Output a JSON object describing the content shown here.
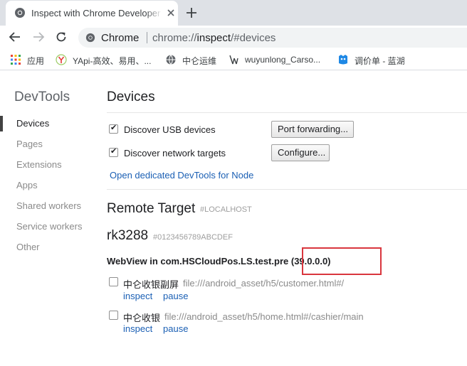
{
  "tab": {
    "title": "Inspect with Chrome Developer Tools"
  },
  "omnibox": {
    "scheme_label": "Chrome",
    "url_prefix": "chrome://",
    "url_host": "inspect",
    "url_path": "/#devices"
  },
  "bookmarks": [
    {
      "label": "应用",
      "icon": "apps-grid-icon"
    },
    {
      "label": "YApi-高效、易用、...",
      "icon": "yapi-icon"
    },
    {
      "label": "中仑运维",
      "icon": "globe-icon"
    },
    {
      "label": "wuyunlong_Carso...",
      "icon": "page-icon"
    },
    {
      "label": "调价单 - 蓝湖",
      "icon": "lanhu-icon"
    }
  ],
  "sidebar": {
    "title": "DevTools",
    "items": [
      {
        "label": "Devices",
        "active": true
      },
      {
        "label": "Pages",
        "active": false
      },
      {
        "label": "Extensions",
        "active": false
      },
      {
        "label": "Apps",
        "active": false
      },
      {
        "label": "Shared workers",
        "active": false
      },
      {
        "label": "Service workers",
        "active": false
      },
      {
        "label": "Other",
        "active": false
      }
    ]
  },
  "devices": {
    "title": "Devices",
    "discover_usb": {
      "label": "Discover USB devices",
      "checked": true,
      "button": "Port forwarding..."
    },
    "discover_network": {
      "label": "Discover network targets",
      "checked": true,
      "button": "Configure..."
    },
    "node_link": "Open dedicated DevTools for Node"
  },
  "remote": {
    "title": "Remote Target",
    "host": "#LOCALHOST",
    "device_name": "rk3288",
    "device_serial": "#0123456789ABCDEF",
    "webview_prefix": "WebView in com.HSCloudPos.LS.test.pre",
    "webview_version": "(39.0.0.0)",
    "targets": [
      {
        "title": "中仑收银副屏",
        "url": "file:///android_asset/h5/customer.html#/",
        "inspect": "inspect",
        "pause": "pause"
      },
      {
        "title": "中仑收银",
        "url": "file:///android_asset/h5/home.html#/cashier/main",
        "inspect": "inspect",
        "pause": "pause"
      }
    ]
  },
  "colors": {
    "tabstrip": "#dee1e6",
    "link": "#1a5fb4",
    "highlight": "#d9363e"
  }
}
